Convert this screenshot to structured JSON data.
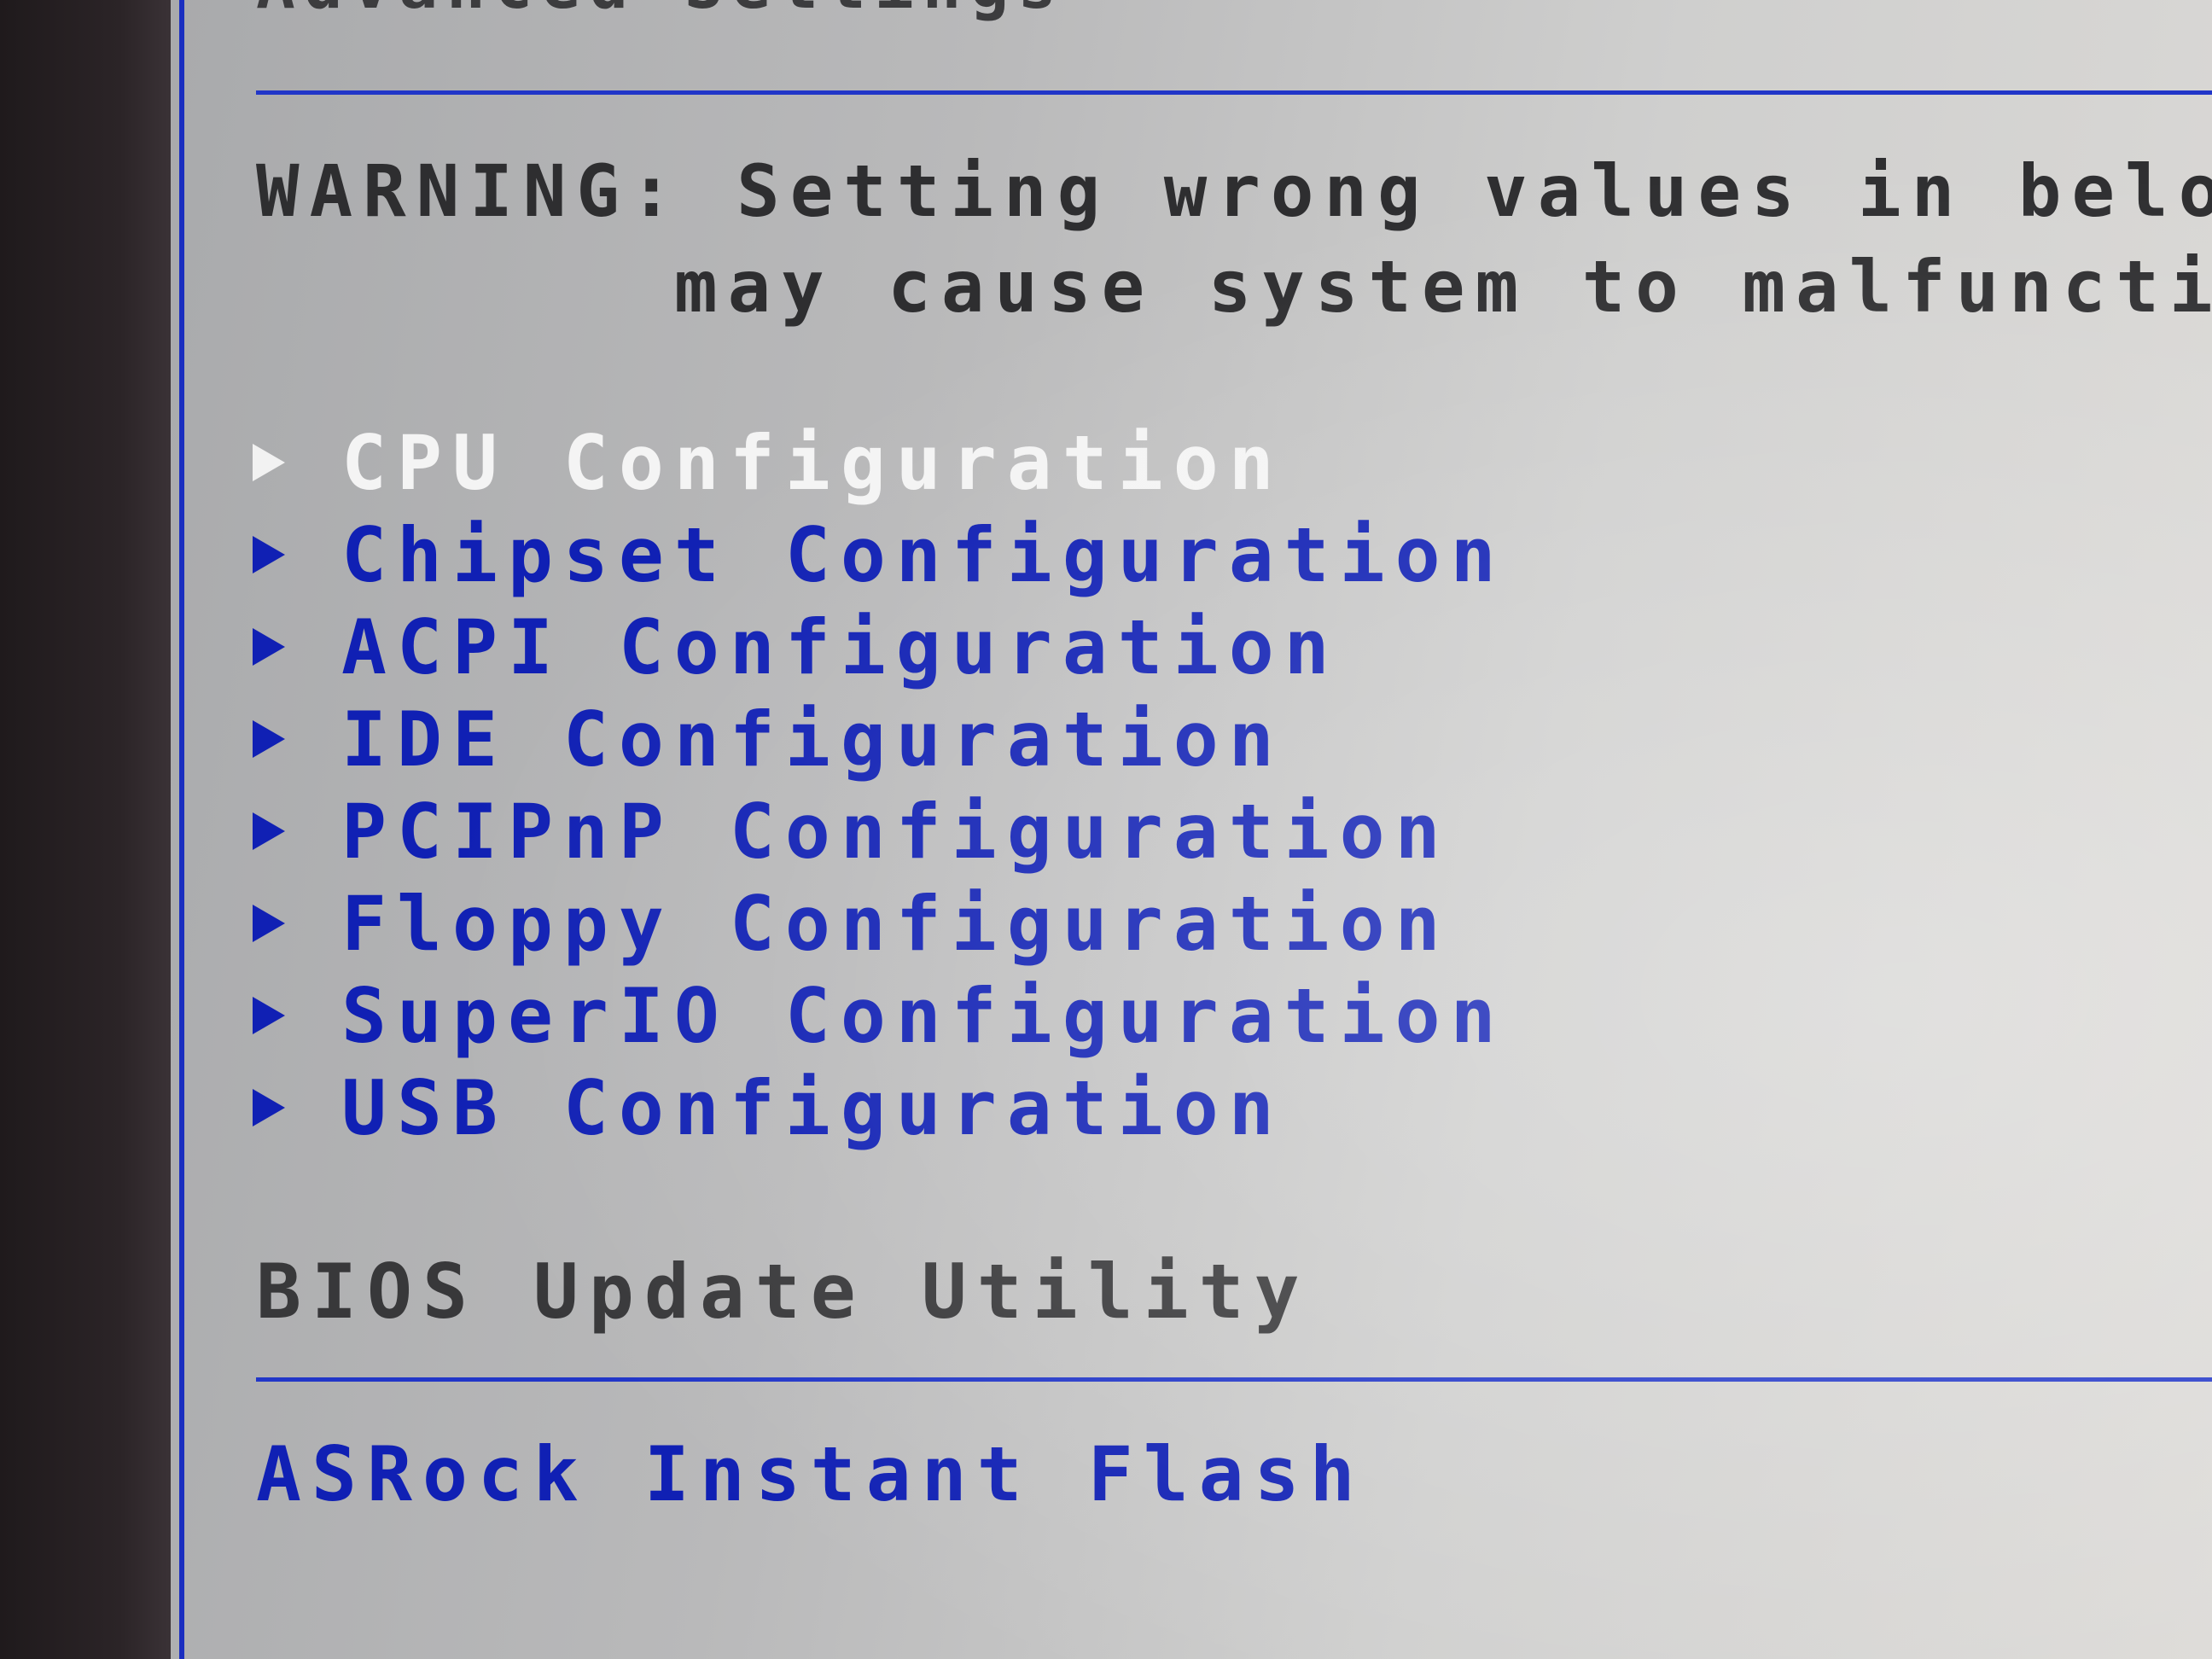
{
  "page": {
    "title": "Advanced Settings"
  },
  "warning": {
    "label": "WARNING:",
    "line1": "Setting wrong values in below sec",
    "line2": "may cause system to malfunction."
  },
  "menu": {
    "selected_index": 0,
    "items": [
      {
        "label": "CPU Configuration",
        "icon": "triangle-right-icon"
      },
      {
        "label": "Chipset Configuration",
        "icon": "triangle-right-icon"
      },
      {
        "label": "ACPI Configuration",
        "icon": "triangle-right-icon"
      },
      {
        "label": "IDE Configuration",
        "icon": "triangle-right-icon"
      },
      {
        "label": "PCIPnP Configuration",
        "icon": "triangle-right-icon"
      },
      {
        "label": "Floppy Configuration",
        "icon": "triangle-right-icon"
      },
      {
        "label": "SuperIO Configuration",
        "icon": "triangle-right-icon"
      },
      {
        "label": "USB Configuration",
        "icon": "triangle-right-icon"
      }
    ]
  },
  "bios_update": {
    "heading": "BIOS Update Utility",
    "item": "ASRock Instant Flash"
  },
  "colors": {
    "item_text": "#1020b4",
    "selected_text": "#f4f4f4",
    "static_text": "#2e2e30",
    "rule": "#2136c8",
    "background": "#c0c0c0"
  }
}
